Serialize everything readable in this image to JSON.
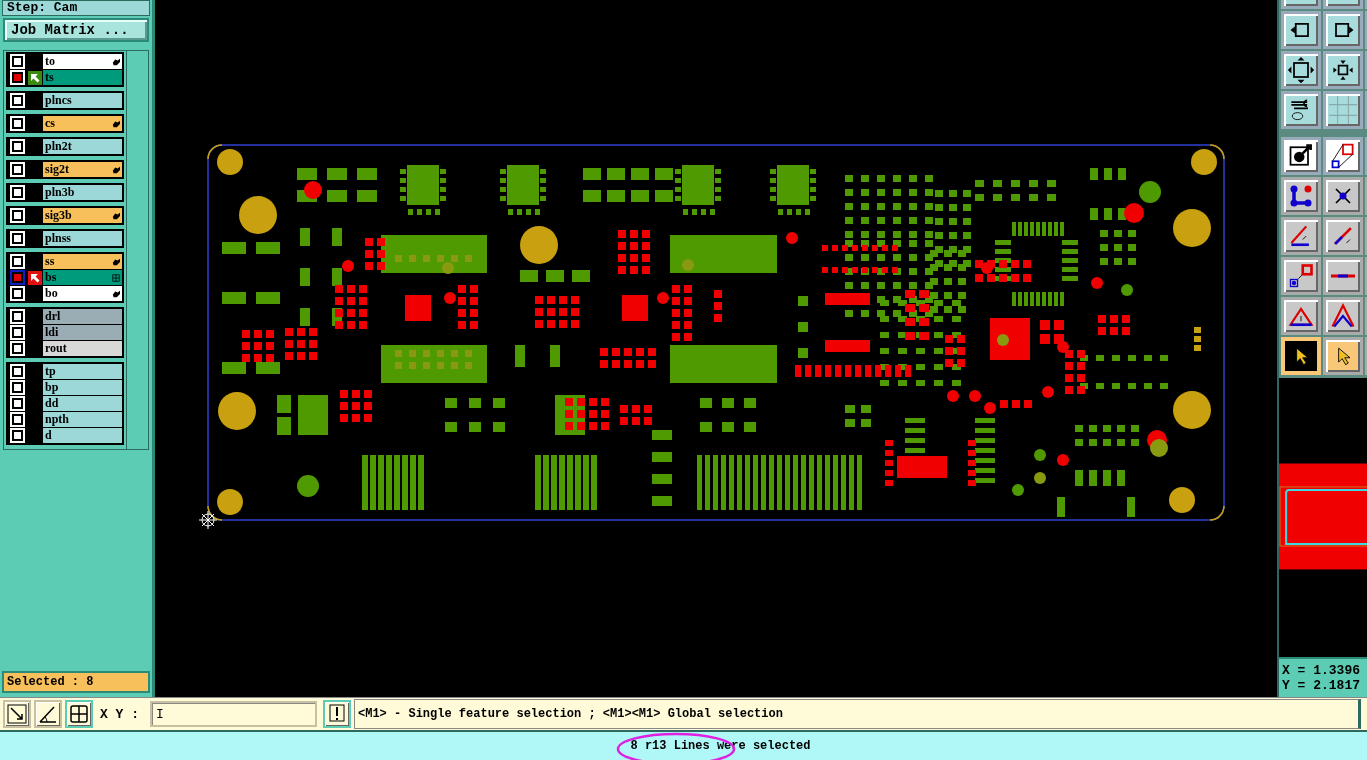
{
  "header": {
    "step_label": "Step: Cam",
    "job_matrix_button": "Job Matrix ..."
  },
  "layer_groups": [
    {
      "layers": [
        {
          "name": "to",
          "color": "#ffffff",
          "checked": false,
          "focused": false,
          "work": false,
          "affected": false,
          "editable": true,
          "merged": false
        },
        {
          "name": "ts",
          "color": "#009b7d",
          "checked": true,
          "focused": false,
          "work": false,
          "affected": true,
          "editable": false,
          "merged": false
        }
      ]
    },
    {
      "layers": [
        {
          "name": "plncs",
          "color": "#9cd8d8",
          "checked": false,
          "focused": false,
          "work": false,
          "affected": false,
          "editable": false,
          "merged": false
        }
      ]
    },
    {
      "layers": [
        {
          "name": "cs",
          "color": "#f8c05a",
          "checked": false,
          "focused": false,
          "work": false,
          "affected": false,
          "editable": true,
          "merged": false
        }
      ]
    },
    {
      "layers": [
        {
          "name": "pln2t",
          "color": "#9cd8d8",
          "checked": false,
          "focused": false,
          "work": false,
          "affected": false,
          "editable": false,
          "merged": false
        }
      ]
    },
    {
      "layers": [
        {
          "name": "sig2t",
          "color": "#f8c05a",
          "checked": false,
          "focused": false,
          "work": false,
          "affected": false,
          "editable": true,
          "merged": false
        }
      ]
    },
    {
      "layers": [
        {
          "name": "pln3b",
          "color": "#9cd8d8",
          "checked": false,
          "focused": false,
          "work": false,
          "affected": false,
          "editable": false,
          "merged": false
        }
      ]
    },
    {
      "layers": [
        {
          "name": "sig3b",
          "color": "#f8c05a",
          "checked": false,
          "focused": false,
          "work": false,
          "affected": false,
          "editable": true,
          "merged": false
        }
      ]
    },
    {
      "layers": [
        {
          "name": "plnss",
          "color": "#9cd8d8",
          "checked": false,
          "focused": false,
          "work": false,
          "affected": false,
          "editable": false,
          "merged": false
        }
      ]
    },
    {
      "layers": [
        {
          "name": "ss",
          "color": "#f8c05a",
          "checked": false,
          "focused": false,
          "work": false,
          "affected": false,
          "editable": true,
          "merged": false
        },
        {
          "name": "bs",
          "color": "#009b7d",
          "checked": true,
          "focused": true,
          "work": true,
          "affected": false,
          "editable": false,
          "merged": true
        },
        {
          "name": "bo",
          "color": "#ffffff",
          "checked": false,
          "focused": false,
          "work": false,
          "affected": false,
          "editable": true,
          "merged": false
        }
      ]
    },
    {
      "layers": [
        {
          "name": "drl",
          "color": "#9aacb4",
          "checked": false,
          "focused": false,
          "work": false,
          "affected": false,
          "editable": false,
          "merged": false
        },
        {
          "name": "ldi",
          "color": "#9aacb4",
          "checked": false,
          "focused": false,
          "work": false,
          "affected": false,
          "editable": false,
          "merged": false
        },
        {
          "name": "rout",
          "color": "#d8d8d8",
          "checked": false,
          "focused": false,
          "work": false,
          "affected": false,
          "editable": false,
          "merged": false
        }
      ]
    },
    {
      "layers": [
        {
          "name": "tp",
          "color": "#9cd8d8",
          "checked": false,
          "focused": false,
          "work": false,
          "affected": false,
          "editable": false,
          "merged": false
        },
        {
          "name": "bp",
          "color": "#9cd8d8",
          "checked": false,
          "focused": false,
          "work": false,
          "affected": false,
          "editable": false,
          "merged": false
        },
        {
          "name": "dd",
          "color": "#9cd8d8",
          "checked": false,
          "focused": false,
          "work": false,
          "affected": false,
          "editable": false,
          "merged": false
        },
        {
          "name": "npth",
          "color": "#9cd8d8",
          "checked": false,
          "focused": false,
          "work": false,
          "affected": false,
          "editable": false,
          "merged": false
        },
        {
          "name": "d",
          "color": "#9cd8d8",
          "checked": false,
          "focused": false,
          "work": false,
          "affected": false,
          "editable": false,
          "merged": false
        }
      ]
    }
  ],
  "selected_count": "Selected : 8",
  "toolbar": [
    {
      "selected": false
    },
    {
      "selected": false
    },
    {
      "selected": false
    },
    {
      "kind": "pan-left",
      "selected": false
    },
    {
      "kind": "pan-right",
      "selected": false
    },
    {
      "selected": false
    },
    {
      "kind": "zoom-fit",
      "selected": false
    },
    {
      "kind": "zoom-in",
      "selected": false
    },
    {
      "selected": false
    },
    {
      "kind": "tools",
      "selected": false
    },
    {
      "kind": "grid",
      "selected": false
    },
    {
      "selected": false
    },
    {
      "kind": "feature-select",
      "selected": false
    },
    {
      "kind": "area-select",
      "selected": false
    },
    {
      "selected": false
    },
    {
      "kind": "net",
      "selected": false
    },
    {
      "kind": "cross",
      "selected": false
    },
    {
      "selected": false
    },
    {
      "kind": "angle-line",
      "selected": false
    },
    {
      "kind": "arrow-line",
      "selected": false
    },
    {
      "selected": false
    },
    {
      "kind": "pad-pick",
      "selected": false
    },
    {
      "kind": "mid-line",
      "selected": false
    },
    {
      "selected": false
    },
    {
      "kind": "triangle",
      "selected": false
    },
    {
      "kind": "peak",
      "selected": false
    },
    {
      "selected": false
    },
    {
      "kind": "pointer",
      "selected": true
    },
    {
      "kind": "pointer",
      "selected": false
    },
    {
      "selected": false
    }
  ],
  "coordinates": {
    "x": "X = 1.3396",
    "y": "Y = 2.1817"
  },
  "command_bar": {
    "xy_label": "X Y :",
    "xy_value": "I",
    "message": "<M1> - Single feature selection ; <M1><M1> Global selection"
  },
  "status_bar": {
    "text": "8 r13 Lines were selected",
    "highlighted": true
  }
}
